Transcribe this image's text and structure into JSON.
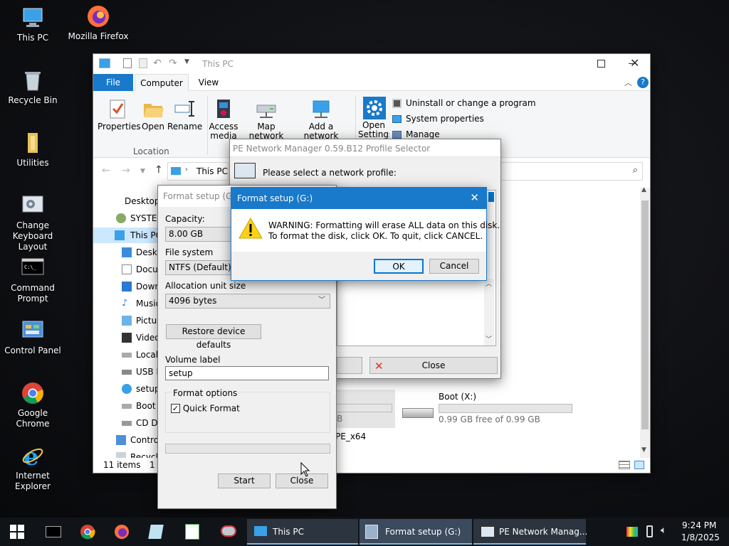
{
  "desktop": {
    "icons": [
      {
        "label": "This PC"
      },
      {
        "label": "Mozilla Firefox"
      },
      {
        "label": "Recycle Bin"
      },
      {
        "label": "Utilities"
      },
      {
        "label": "Change Keyboard Layout"
      },
      {
        "label": "Command Prompt"
      },
      {
        "label": "Control Panel"
      },
      {
        "label": "Google Chrome"
      },
      {
        "label": "Internet Explorer"
      }
    ]
  },
  "explorer": {
    "title": "This PC",
    "tabs": {
      "file": "File",
      "computer": "Computer",
      "view": "View"
    },
    "ribbon": {
      "properties": "Properties",
      "open": "Open",
      "rename": "Rename",
      "group_location": "Location",
      "access_media": "Access media",
      "map_drive": "Map network drive",
      "add_location": "Add a network location",
      "open_settings": "Open Settings",
      "uninstall": "Uninstall or change a program",
      "system_props": "System properties",
      "manage": "Manage"
    },
    "address": "This PC",
    "nav": [
      "Desktop",
      "SYSTEM",
      "This PC",
      "Deskt",
      "Docu",
      "Dowr",
      "Music",
      "Pictur",
      "Video",
      "Local",
      "USB D",
      "setup",
      "Boot",
      "CD Dr",
      "Contro",
      "Recycl"
    ],
    "status_items": "11 items",
    "status_sel": "1 i",
    "drives": {
      "boot_name": "Boot (X:)",
      "boot_free": "0.99 GB free of 0.99 GB",
      "pe_label": "PE_x64",
      "b_label": "B"
    }
  },
  "netmgr": {
    "title": "PE Network Manager 0.59.B12 Profile Selector",
    "prompt": "Please select a network profile:",
    "close": "Close"
  },
  "format_setup": {
    "title": "Format setup (G:)",
    "capacity_label": "Capacity:",
    "capacity_value": "8.00 GB",
    "fs_label": "File system",
    "fs_value": "NTFS (Default)",
    "alloc_label": "Allocation unit size",
    "alloc_value": "4096 bytes",
    "restore": "Restore device defaults",
    "vol_label": "Volume label",
    "vol_value": "setup",
    "options_label": "Format options",
    "quick": "Quick Format",
    "start": "Start",
    "close": "Close"
  },
  "warning": {
    "title": "Format setup (G:)",
    "line1": "WARNING: Formatting will erase ALL data on this disk.",
    "line2": "To format the disk, click OK. To quit, click CANCEL.",
    "ok": "OK",
    "cancel": "Cancel"
  },
  "taskbar": {
    "apps": [
      {
        "label": "This PC"
      },
      {
        "label": "Format setup (G:)"
      },
      {
        "label": "PE Network Manag..."
      }
    ],
    "time": "9:24 PM",
    "date": "1/8/2025"
  }
}
